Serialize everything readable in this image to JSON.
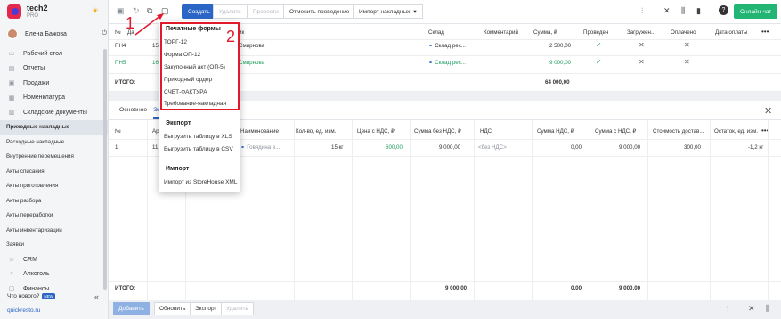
{
  "brand": {
    "name": "tech2",
    "plan": "PRO"
  },
  "user": {
    "name": "Елена Бажова"
  },
  "nav": [
    {
      "label": "Рабочий стол",
      "icon": "desktop-icon"
    },
    {
      "label": "Отчеты",
      "icon": "reports-icon"
    },
    {
      "label": "Продажи",
      "icon": "sales-icon"
    },
    {
      "label": "Номенклатура",
      "icon": "nomenclature-icon"
    },
    {
      "label": "Складские документы",
      "icon": "warehouse-docs-icon"
    }
  ],
  "subnav": [
    "Приходные накладные",
    "Расходные накладные",
    "Внутренние перемещения",
    "Акты списания",
    "Акты приготовления",
    "Акты разбора",
    "Акты переработки",
    "Акты инвентаризации",
    "Заявки"
  ],
  "nav_bottom": [
    {
      "label": "CRM",
      "icon": "crm-icon"
    },
    {
      "label": "Алкоголь",
      "icon": "alcohol-icon"
    },
    {
      "label": "Финансы",
      "icon": "finance-icon"
    }
  ],
  "whatsnew": {
    "label": "Что нового?",
    "badge": "NEW"
  },
  "site_link": "quickresto.ru",
  "toolbar": {
    "create": "Создать",
    "delete": "Удалить",
    "post": "Провести",
    "unpost": "Отменить проведение",
    "import": "Импорт накладных",
    "chat": "Онлайн-чат"
  },
  "upper_table": {
    "headers": [
      "№",
      "Да",
      "ик",
      "Склад",
      "Комментарий",
      "Сумма, ₽",
      "Проведен",
      "Загружен...",
      "Оплачено",
      "Дата оплаты"
    ],
    "rows": [
      {
        "num": "ПН4",
        "date": "15",
        "supplier": "Смирнова",
        "warehouse": "Склад рес...",
        "sum": "2 500,00"
      },
      {
        "num": "ПН5",
        "date": "16",
        "supplier": "Смирнова",
        "warehouse": "Склад рес...",
        "sum": "9 000,00"
      }
    ],
    "total_label": "ИТОГО:",
    "total_sum": "64 000,00"
  },
  "tabs": {
    "main": "Основное",
    "second": "Эл"
  },
  "lower_table": {
    "headers": [
      "№",
      "Ар",
      "Наименование",
      "Кол-во, ед. изм.",
      "Цена с НДС, ₽",
      "Сумма без НДС, ₽",
      "НДС",
      "Сумма НДС, ₽",
      "Сумма с НДС, ₽",
      "Стоимость достав...",
      "Остаток, ед. изм."
    ],
    "row": {
      "num": "1",
      "art": "11",
      "name": "Говядина в...",
      "qty": "15 кг",
      "price": "600,00",
      "sum_no_vat": "9 000,00",
      "vat": "<без НДС>",
      "vat_sum": "0,00",
      "sum_vat": "9 000,00",
      "delivery": "300,00",
      "rest": "-1,2 кг"
    },
    "total_label": "ИТОГО:",
    "totals": {
      "sum_no_vat": "9 000,00",
      "vat_sum": "0,00",
      "sum_vat": "9 000,00"
    }
  },
  "bottom": {
    "add": "Добавить",
    "refresh": "Обновить",
    "export": "Экспорт",
    "delete": "Удалить"
  },
  "dropdown": {
    "print_head": "Печатные формы",
    "print_items": [
      "ТОРГ-12",
      "Форма ОП-12",
      "Закупочный акт (ОП-5)",
      "Приходный ордер",
      "СЧЕТ-ФАКТУРА",
      "Требование-накладная"
    ],
    "export_head": "Экспорт",
    "export_items": [
      "Выгрузить таблицу в XLS",
      "Выгрузить таблицу в CSV"
    ],
    "import_head": "Импорт",
    "import_items": [
      "Импорт из StoreHouse XML"
    ]
  },
  "annotations": {
    "one": "1",
    "two": "2"
  }
}
